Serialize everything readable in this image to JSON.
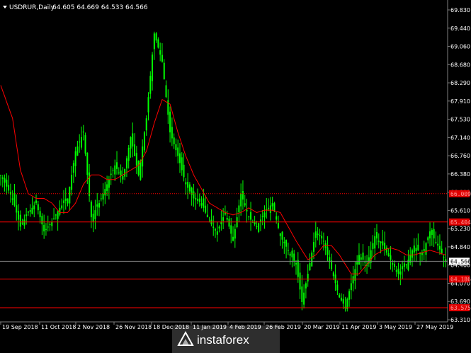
{
  "header": {
    "symbol_timeframe": "USDRUR,Daily",
    "ohlc": "64.605 64.669 64.533 64.566"
  },
  "colors": {
    "background": "#000000",
    "bull_bar": "#00ff00",
    "moving_average": "#ff0000",
    "level_line": "#ff0000",
    "level_tag_bg": "#e00000",
    "axis": "#808080",
    "text": "#ffffff",
    "price_tag_bg": "#ffffff",
    "price_tag_text": "#000000",
    "grid": "none"
  },
  "logo": {
    "brand": "instaforex",
    "icon": "triangle-logo-icon"
  },
  "chart_data": {
    "type": "candlestick-bars",
    "title": "USDRUR,Daily",
    "grid": false,
    "ylim": [
      63.31,
      69.9
    ],
    "yticks": [
      "69.830",
      "69.440",
      "69.060",
      "68.680",
      "68.290",
      "67.910",
      "67.530",
      "67.140",
      "66.760",
      "66.380",
      "66.000",
      "65.610",
      "65.230",
      "64.840",
      "64.460",
      "64.070",
      "63.690",
      "63.310"
    ],
    "xticks": [
      "19 Sep 2018",
      "11 Oct 2018",
      "2 Nov 2018",
      "26 Nov 2018",
      "18 Dec 2018",
      "11 Jan 2019",
      "4 Feb 2019",
      "26 Feb 2019",
      "20 Mar 2019",
      "11 Apr 2019",
      "3 May 2019",
      "27 May 2019"
    ],
    "current_price": "64.566",
    "levels": [
      {
        "value": 66.0,
        "label": "66.009"
      },
      {
        "value": 65.4,
        "label": "65.404"
      },
      {
        "value": 64.19,
        "label": "64.186"
      },
      {
        "value": 63.58,
        "label": "63.575"
      }
    ],
    "close_path": [
      [
        0,
        66.4
      ],
      [
        6,
        65.9
      ],
      [
        10,
        65.3
      ],
      [
        14,
        65.6
      ],
      [
        18,
        65.8
      ],
      [
        22,
        65.2
      ],
      [
        26,
        65.4
      ],
      [
        30,
        65.7
      ],
      [
        34,
        65.9
      ],
      [
        38,
        66.9
      ],
      [
        42,
        67.3
      ],
      [
        46,
        65.5
      ],
      [
        50,
        65.8
      ],
      [
        54,
        66.2
      ],
      [
        58,
        66.6
      ],
      [
        62,
        66.3
      ],
      [
        66,
        67.2
      ],
      [
        70,
        66.4
      ],
      [
        74,
        67.6
      ],
      [
        78,
        69.4
      ],
      [
        82,
        68.8
      ],
      [
        86,
        67.3
      ],
      [
        90,
        66.8
      ],
      [
        94,
        66.2
      ],
      [
        98,
        65.9
      ],
      [
        102,
        65.8
      ],
      [
        106,
        65.4
      ],
      [
        110,
        65.2
      ],
      [
        114,
        65.6
      ],
      [
        118,
        65.0
      ],
      [
        122,
        66.0
      ],
      [
        126,
        65.5
      ],
      [
        130,
        65.3
      ],
      [
        134,
        65.6
      ],
      [
        138,
        65.8
      ],
      [
        142,
        65.1
      ],
      [
        146,
        64.8
      ],
      [
        150,
        64.5
      ],
      [
        153,
        63.7
      ],
      [
        156,
        64.3
      ],
      [
        160,
        65.2
      ],
      [
        164,
        65.0
      ],
      [
        168,
        64.4
      ],
      [
        172,
        63.8
      ],
      [
        175,
        63.6
      ],
      [
        178,
        64.1
      ],
      [
        182,
        64.7
      ],
      [
        186,
        64.5
      ],
      [
        190,
        65.1
      ],
      [
        194,
        64.9
      ],
      [
        198,
        64.6
      ],
      [
        202,
        64.3
      ],
      [
        206,
        64.5
      ],
      [
        210,
        64.9
      ],
      [
        214,
        64.7
      ],
      [
        218,
        65.2
      ],
      [
        222,
        64.9
      ],
      [
        226,
        64.57
      ]
    ],
    "moving_average": [
      [
        0,
        68.3
      ],
      [
        6,
        67.6
      ],
      [
        10,
        66.5
      ],
      [
        14,
        66.0
      ],
      [
        18,
        65.9
      ],
      [
        22,
        65.9
      ],
      [
        26,
        65.8
      ],
      [
        30,
        65.6
      ],
      [
        34,
        65.6
      ],
      [
        38,
        65.8
      ],
      [
        42,
        66.2
      ],
      [
        46,
        66.4
      ],
      [
        50,
        66.4
      ],
      [
        54,
        66.3
      ],
      [
        58,
        66.3
      ],
      [
        62,
        66.4
      ],
      [
        66,
        66.5
      ],
      [
        70,
        66.6
      ],
      [
        74,
        66.9
      ],
      [
        78,
        67.5
      ],
      [
        82,
        68.0
      ],
      [
        86,
        67.9
      ],
      [
        90,
        67.3
      ],
      [
        94,
        66.8
      ],
      [
        98,
        66.4
      ],
      [
        102,
        66.1
      ],
      [
        106,
        65.8
      ],
      [
        110,
        65.7
      ],
      [
        114,
        65.6
      ],
      [
        118,
        65.55
      ],
      [
        122,
        65.6
      ],
      [
        126,
        65.7
      ],
      [
        130,
        65.6
      ],
      [
        134,
        65.65
      ],
      [
        138,
        65.65
      ],
      [
        142,
        65.6
      ],
      [
        146,
        65.3
      ],
      [
        150,
        65.0
      ],
      [
        153,
        64.8
      ],
      [
        156,
        64.6
      ],
      [
        160,
        64.7
      ],
      [
        164,
        64.9
      ],
      [
        168,
        64.9
      ],
      [
        172,
        64.7
      ],
      [
        175,
        64.5
      ],
      [
        178,
        64.3
      ],
      [
        182,
        64.3
      ],
      [
        186,
        64.5
      ],
      [
        190,
        64.7
      ],
      [
        194,
        64.8
      ],
      [
        198,
        64.85
      ],
      [
        202,
        64.8
      ],
      [
        206,
        64.7
      ],
      [
        210,
        64.7
      ],
      [
        214,
        64.75
      ],
      [
        218,
        64.8
      ],
      [
        222,
        64.75
      ],
      [
        226,
        64.7
      ]
    ]
  }
}
